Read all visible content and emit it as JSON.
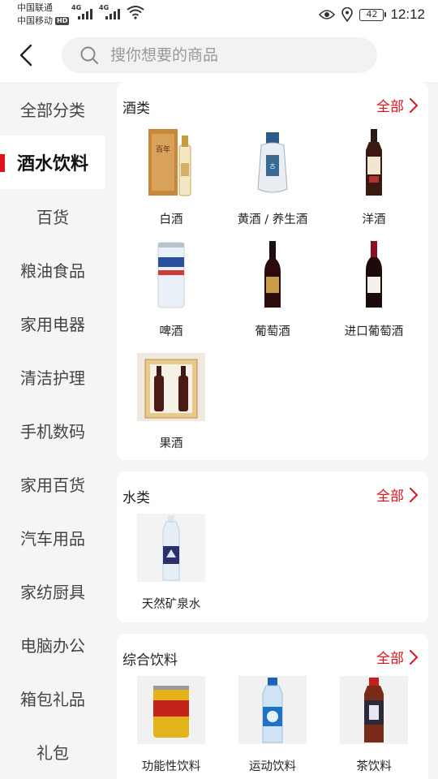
{
  "status_bar": {
    "carrier_1": "中国联通",
    "carrier_2": "中国移动",
    "hd": "HD",
    "net_1": "4G",
    "net_2": "4G",
    "battery": "42",
    "time": "12:12"
  },
  "search": {
    "placeholder": "搜你想要的商品"
  },
  "sidebar": {
    "items": [
      {
        "label": "全部分类"
      },
      {
        "label": "酒水饮料"
      },
      {
        "label": "百货"
      },
      {
        "label": "粮油食品"
      },
      {
        "label": "家用电器"
      },
      {
        "label": "清洁护理"
      },
      {
        "label": "手机数码"
      },
      {
        "label": "家用百货"
      },
      {
        "label": "汽车用品"
      },
      {
        "label": "家纺厨具"
      },
      {
        "label": "电脑办公"
      },
      {
        "label": "箱包礼品"
      },
      {
        "label": "礼包"
      }
    ],
    "active_index": 1
  },
  "sections": [
    {
      "title": "酒类",
      "all_label": "全部",
      "items": [
        {
          "label": "白酒",
          "icon": "baijiu-gift-box"
        },
        {
          "label": "黄酒 / 养生酒",
          "icon": "ceramic-wine-jar"
        },
        {
          "label": "洋酒",
          "icon": "whisky-bottle"
        },
        {
          "label": "啤酒",
          "icon": "beer-can"
        },
        {
          "label": "葡萄酒",
          "icon": "red-wine-bottle"
        },
        {
          "label": "进口葡萄酒",
          "icon": "imported-wine-bottle"
        },
        {
          "label": "果酒",
          "icon": "fruit-wine-gift-box"
        }
      ]
    },
    {
      "title": "水类",
      "all_label": "全部",
      "items": [
        {
          "label": "天然矿泉水",
          "icon": "mineral-water-bottle"
        }
      ]
    },
    {
      "title": "综合饮料",
      "all_label": "全部",
      "items": [
        {
          "label": "功能性饮料",
          "icon": "energy-drink-can"
        },
        {
          "label": "运动饮料",
          "icon": "sports-drink-bottle"
        },
        {
          "label": "茶饮料",
          "icon": "tea-drink-bottle"
        }
      ]
    }
  ],
  "colors": {
    "accent": "#e01020",
    "sidebar_bg": "#f5f5f5",
    "card_bg": "#ffffff"
  }
}
